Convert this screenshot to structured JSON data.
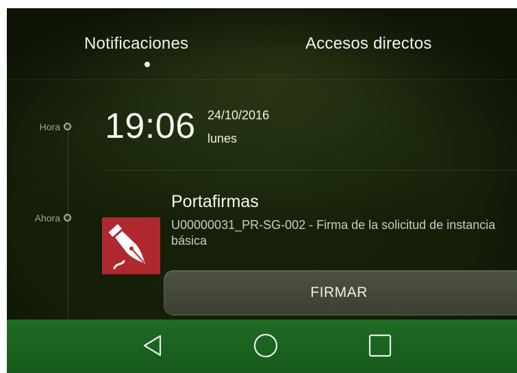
{
  "tabs": [
    {
      "label": "Notificaciones",
      "active": true
    },
    {
      "label": "Accesos directos",
      "active": false
    }
  ],
  "timeline": {
    "hora_label": "Hora",
    "ahora_label": "Ahora"
  },
  "clock": {
    "time": "19:06",
    "date": "24/10/2016",
    "day": "lunes"
  },
  "notification": {
    "app_name": "Portafirmas",
    "icon": "fountain-pen-icon",
    "text": "U00000031_PR-SG-002 - Firma de la solicitud de instancia básica",
    "action_label": "FIRMAR"
  },
  "navbar": {
    "icons": [
      "back-icon",
      "home-icon",
      "recent-apps-icon"
    ]
  },
  "colors": {
    "background": "#1c270c",
    "navbar": "#1f6b24",
    "app_icon": "#b0282f"
  }
}
